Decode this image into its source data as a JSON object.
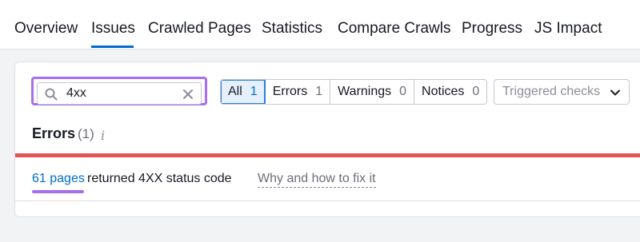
{
  "tabs": [
    {
      "label": "Overview"
    },
    {
      "label": "Issues",
      "active": true
    },
    {
      "label": "Crawled Pages"
    },
    {
      "label": "Statistics"
    },
    {
      "label": "Compare Crawls"
    },
    {
      "label": "Progress"
    },
    {
      "label": "JS Impact"
    }
  ],
  "search": {
    "value": "4xx",
    "icon": "search-icon",
    "clear_icon": "close-icon"
  },
  "filters": [
    {
      "label": "All",
      "count": "1",
      "active": true
    },
    {
      "label": "Errors",
      "count": "1"
    },
    {
      "label": "Warnings",
      "count": "0"
    },
    {
      "label": "Notices",
      "count": "0"
    }
  ],
  "dropdown": {
    "placeholder": "Triggered checks",
    "icon": "chevron-down-icon"
  },
  "section": {
    "title": "Errors",
    "count": "(1)",
    "info": "i"
  },
  "issue": {
    "link_text": "61 pages",
    "text": "returned 4XX status code",
    "fix_link": "Why and how to fix it"
  },
  "colors": {
    "accent": "#006dca",
    "highlight": "#a66ff0",
    "error": "#e05653"
  }
}
